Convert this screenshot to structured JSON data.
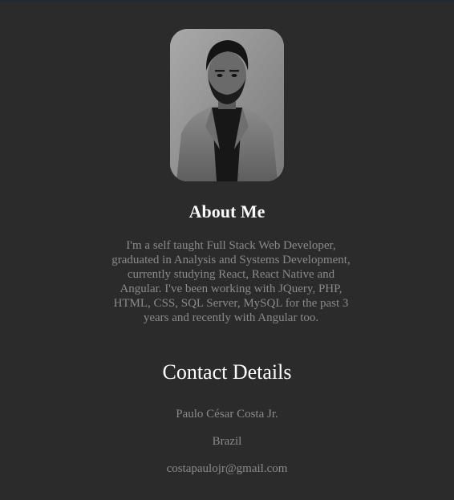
{
  "colors": {
    "background": "#2b2b2b",
    "heading": "#ffffff",
    "body_text": "#8a8a8a"
  },
  "profile": {
    "photo_icon": "portrait-photo"
  },
  "about": {
    "title": "About Me",
    "text": "I'm a self taught Full Stack Web Developer, graduated in Analysis and Systems Development, currently studying React, React Native and Angular. I've been working with JQuery, PHP, HTML, CSS, SQL Server, MySQL for the past 3 years and recently with Angular too."
  },
  "contact": {
    "title": "Contact Details",
    "name": "Paulo César Costa Jr.",
    "country": "Brazil",
    "email": "costapaulojr@gmail.com"
  }
}
